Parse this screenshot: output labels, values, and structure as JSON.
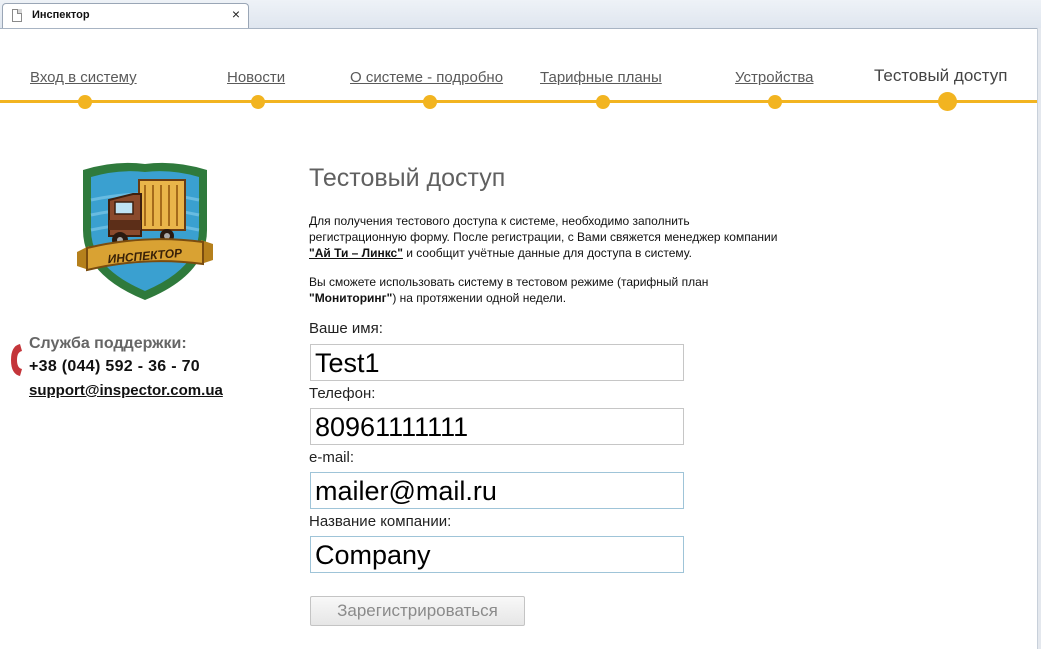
{
  "browser": {
    "tab_title": "Инспектор",
    "close_glyph": "×"
  },
  "nav": {
    "items": [
      {
        "label": "Вход в систему"
      },
      {
        "label": "Новости"
      },
      {
        "label": "О системе - подробно"
      },
      {
        "label": "Тарифные планы"
      },
      {
        "label": "Устройства"
      },
      {
        "label": "Тестовый доступ",
        "active": true
      }
    ]
  },
  "logo": {
    "text": "ИНСПЕКТОР"
  },
  "support": {
    "title": "Служба поддержки:",
    "phone": "+38 (044) 592 - 36 - 70",
    "email": "support@inspector.com.ua"
  },
  "main": {
    "title": "Тестовый доступ",
    "intro1_line1": "Для получения тестового доступа к системе, необходимо заполнить",
    "intro1_line2": "регистрационную форму. После регистрации, с Вами свяжется менеджер компании",
    "intro1_company": "\"Ай Ти – Линкс\"",
    "intro1_line3_rest": " и сообщит учётные данные для доступа в систему.",
    "intro2_line1": "Вы сможете использовать систему в тестовом режиме (тарифный план",
    "intro2_plan": "\"Мониторинг\"",
    "intro2_line2_rest": ") на протяжении одной недели."
  },
  "form": {
    "name_label": "Ваше имя:",
    "name_value": "Test1",
    "phone_label": "Телефон:",
    "phone_value": "80961111111",
    "email_label": "e-mail:",
    "email_value": "mailer@mail.ru",
    "company_label": "Название компании:",
    "company_value": "Company",
    "submit_label": "Зарегистрироваться"
  },
  "colors": {
    "accent": "#f2b420",
    "shield_green": "#2f7a3c",
    "shield_blue": "#3aa0d0",
    "ribbon": "#d9a233"
  }
}
